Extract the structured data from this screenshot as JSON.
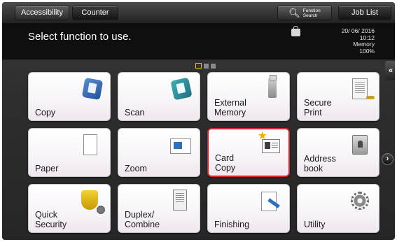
{
  "topbar": {
    "accessibility_label": "Accessibility",
    "counter_label": "Counter",
    "function_search_line1": "Function",
    "function_search_line2": "Search",
    "job_list_label": "Job List"
  },
  "message": {
    "text": "Select function to use.",
    "date": "20/ 06/ 2016",
    "time": "10:12",
    "memory_label": "Memory",
    "memory_value": "100%"
  },
  "nav": {
    "collapse_glyph": "«",
    "next_glyph": "›"
  },
  "tiles": [
    {
      "label": "Copy",
      "icon": "copy-icon"
    },
    {
      "label": "Scan",
      "icon": "scan-icon"
    },
    {
      "label": "External\nMemory",
      "icon": "usb-memory-icon"
    },
    {
      "label": "Secure\nPrint",
      "icon": "secure-print-icon"
    },
    {
      "label": "Paper",
      "icon": "paper-icon"
    },
    {
      "label": "Zoom",
      "icon": "zoom-icon"
    },
    {
      "label": "Card\nCopy",
      "icon": "card-copy-icon",
      "selected": true
    },
    {
      "label": "Address\nbook",
      "icon": "address-book-icon"
    },
    {
      "label": "Quick\nSecurity",
      "icon": "quick-security-icon"
    },
    {
      "label": "Duplex/\nCombine",
      "icon": "duplex-icon"
    },
    {
      "label": "Finishing",
      "icon": "finishing-icon"
    },
    {
      "label": "Utility",
      "icon": "utility-icon"
    }
  ],
  "colors": {
    "selected_border": "#d6252b",
    "page_indicator_active": "#f2c000"
  }
}
